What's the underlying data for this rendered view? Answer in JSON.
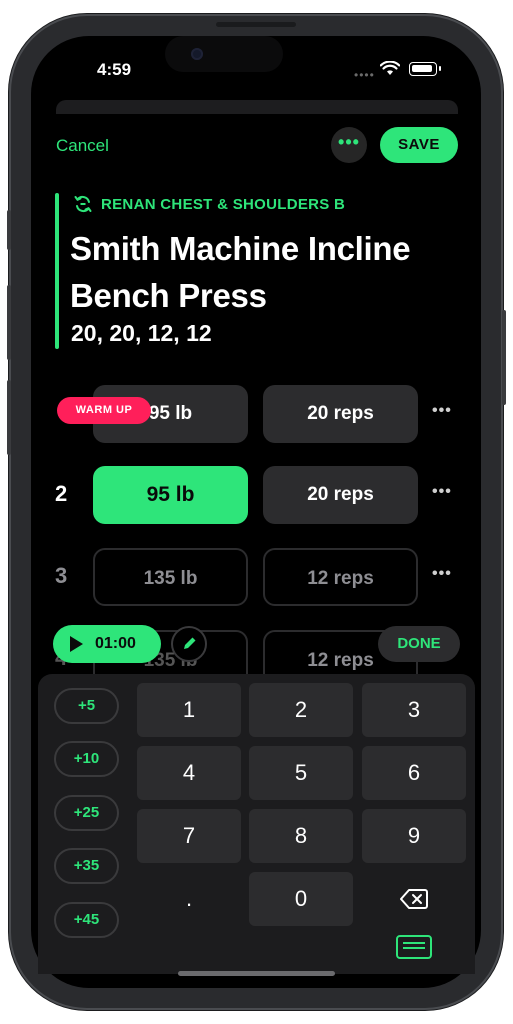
{
  "status": {
    "time": "4:59",
    "dots": "••••"
  },
  "header": {
    "cancel": "Cancel",
    "more": "•••",
    "save": "SAVE"
  },
  "exercise": {
    "routine": "RENAN CHEST & SHOULDERS B",
    "title": "Smith Machine Incline Bench Press",
    "reps_summary": "20, 20, 12, 12"
  },
  "sets": [
    {
      "number": "",
      "badge": "WARM UP",
      "weight": "95 lb",
      "reps": "20 reps",
      "state": "filled"
    },
    {
      "number": "2",
      "weight": "95 lb",
      "reps": "20 reps",
      "state": "active"
    },
    {
      "number": "3",
      "weight": "135 lb",
      "reps": "12 reps",
      "state": "outline"
    },
    {
      "number": "4",
      "weight": "135 lb",
      "reps": "12 reps",
      "state": "outline"
    }
  ],
  "set_more": "•••",
  "timer": {
    "label": "01:00"
  },
  "done": "DONE",
  "increments": [
    "+5",
    "+10",
    "+25",
    "+35",
    "+45"
  ],
  "keys": [
    "1",
    "2",
    "3",
    "4",
    "5",
    "6",
    "7",
    "8",
    "9",
    ".",
    "0",
    "⌫"
  ],
  "colors": {
    "accent": "#2ee57a",
    "warmup": "#ff1f5a",
    "background": "#000000"
  }
}
